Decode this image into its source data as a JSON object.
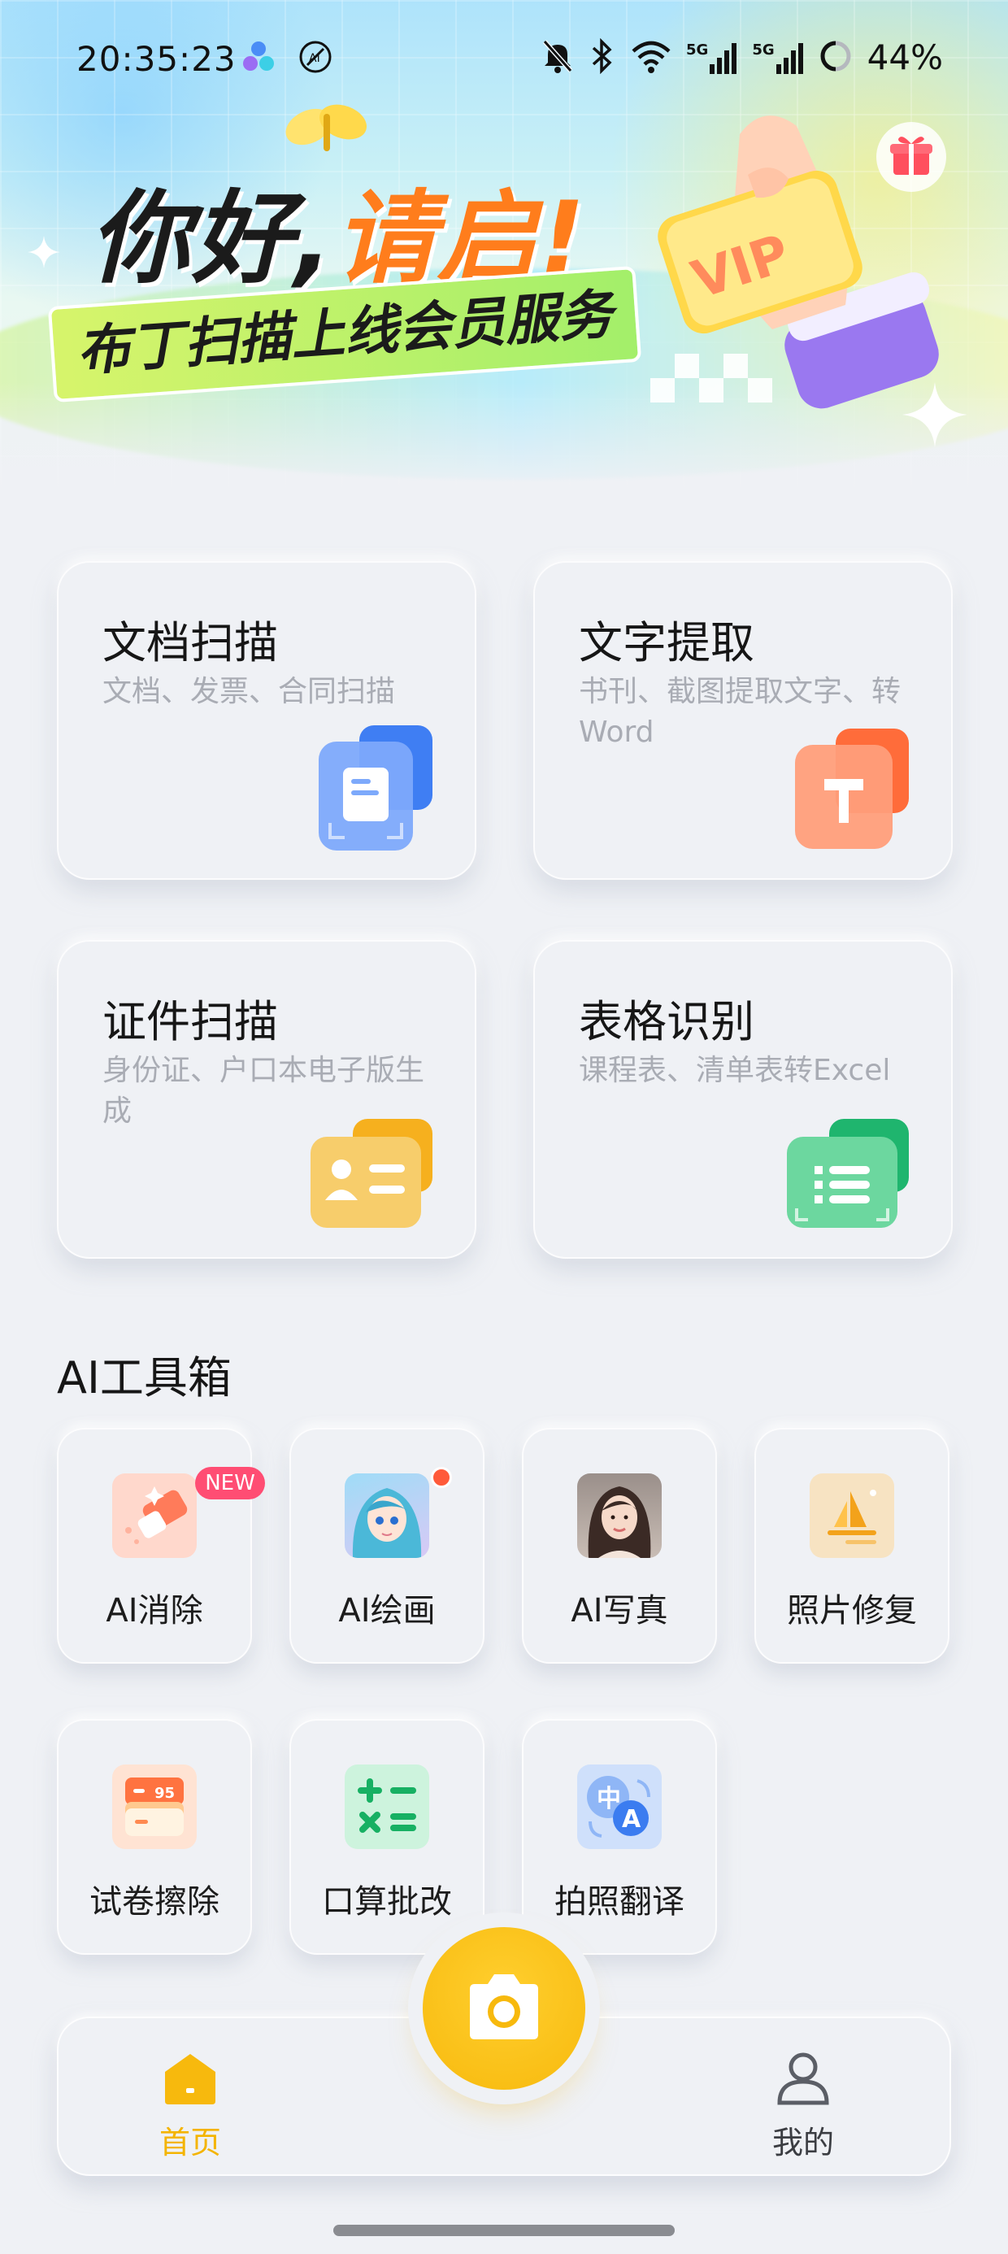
{
  "status_bar": {
    "time": "20:35:23",
    "battery": "44%",
    "network_labels": [
      "5G",
      "5G"
    ],
    "icons": [
      "app-circles-icon",
      "ai-badge-icon",
      "bell-muted-icon",
      "bluetooth-icon",
      "wifi-icon",
      "signal-5g-icon",
      "signal-5g-icon",
      "battery-ring-icon"
    ]
  },
  "banner": {
    "headline_part1": "你好,",
    "headline_part2": "请启!",
    "subtitle": "布丁扫描上线会员服务",
    "vip_label": "VIP",
    "gift_icon": "gift-icon"
  },
  "features": [
    {
      "title": "文档扫描",
      "desc": "文档、发票、合同扫描",
      "icon": "document-scan-icon",
      "color": "#4c86f5"
    },
    {
      "title": "文字提取",
      "desc": "书刊、截图提取文字、转Word",
      "icon": "text-extract-icon",
      "color": "#ff7b4a"
    },
    {
      "title": "证件扫描",
      "desc": "身份证、户口本电子版生成",
      "icon": "id-card-icon",
      "color": "#f6b82a"
    },
    {
      "title": "表格识别",
      "desc": "课程表、清单表转Excel",
      "icon": "table-recognize-icon",
      "color": "#27c27a"
    }
  ],
  "ai_section": {
    "title": "AI工具箱",
    "tools": [
      {
        "label": "AI消除",
        "badge": "NEW",
        "icon": "eraser-icon"
      },
      {
        "label": "AI绘画",
        "icon": "anime-portrait-icon"
      },
      {
        "label": "AI写真",
        "icon": "photo-portrait-icon"
      },
      {
        "label": "照片修复",
        "icon": "photo-restore-icon"
      },
      {
        "label": "试卷擦除",
        "icon": "exam-erase-icon",
        "score": "95"
      },
      {
        "label": "口算批改",
        "icon": "calculator-icon"
      },
      {
        "label": "拍照翻译",
        "icon": "translate-icon",
        "glyph_zh": "中",
        "glyph_en": "A"
      }
    ]
  },
  "bottom_nav": {
    "home_label": "首页",
    "mine_label": "我的",
    "camera_icon": "camera-icon",
    "active_color": "#f4b400"
  }
}
